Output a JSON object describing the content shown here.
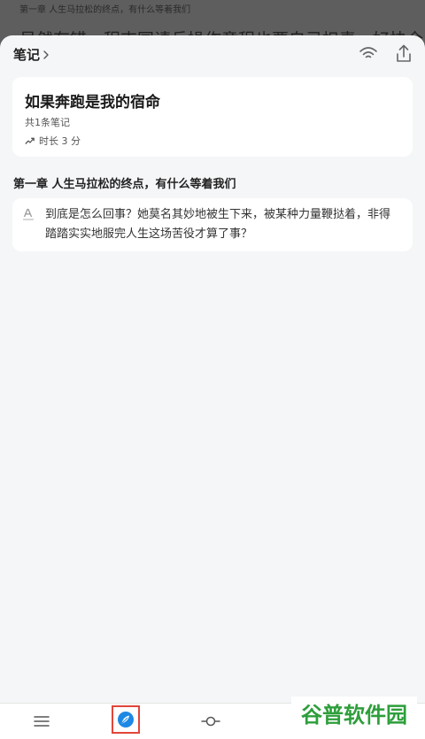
{
  "reader": {
    "chapter_header": "第一章  人生马拉松的终点，有什么等着我们",
    "body_line": "虽然有错，程吉国请兵操作意程也要自己担责，好快全厂里开始从"
  },
  "notes_panel": {
    "title": "笔记",
    "icons": {
      "left_header": "wireless-signal-icon",
      "right_header": "share-icon"
    },
    "book": {
      "title": "如果奔跑是我的宿命",
      "note_count": "共1条笔记",
      "duration": "时长 3 分"
    },
    "chapters": [
      {
        "title": "第一章  人生马拉松的终点，有什么等着我们",
        "notes": [
          {
            "icon": "text-note-icon",
            "text": "到底是怎么回事？她莫名其妙地被生下来，被某种力量鞭挞着，非得踏踏实实地服完人生这场苦役才算了事？"
          }
        ]
      }
    ]
  },
  "toolbar": {
    "items": [
      {
        "name": "menu",
        "icon": "menu-icon"
      },
      {
        "name": "notes",
        "icon": "feather-icon",
        "selected": true
      },
      {
        "name": "progress",
        "icon": "progress-icon"
      }
    ],
    "accent": "#1e88e5",
    "highlight": "#e0463a"
  },
  "watermark": {
    "text": "谷普软件园",
    "color": "#2e9e3b"
  }
}
